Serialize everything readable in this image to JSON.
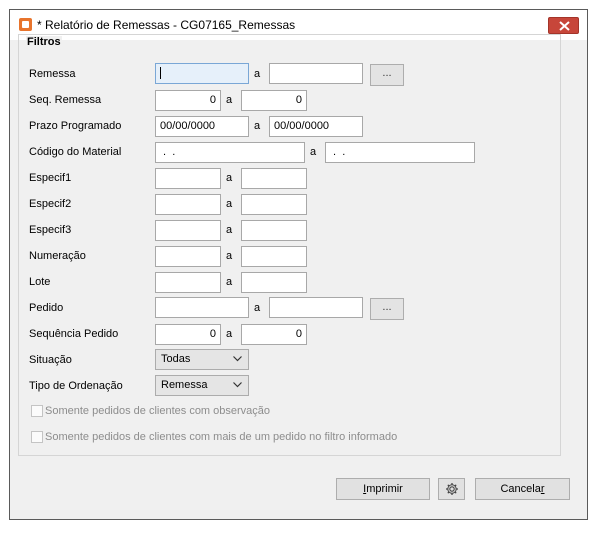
{
  "window": {
    "title": "* Relatório de Remessas - CG07165_Remessas"
  },
  "group": {
    "label": "Filtros"
  },
  "separator": "a",
  "fields": {
    "remessa": {
      "label": "Remessa",
      "from": "",
      "to": ""
    },
    "seq_remessa": {
      "label": "Seq. Remessa",
      "from": "0",
      "to": "0"
    },
    "prazo_programado": {
      "label": "Prazo Programado",
      "from": "00/00/0000",
      "to": "00/00/0000"
    },
    "codigo_material": {
      "label": "Código do Material",
      "from": " .  .",
      "to": " .  ."
    },
    "especif1": {
      "label": "Especif1",
      "from": "",
      "to": ""
    },
    "especif2": {
      "label": "Especif2",
      "from": "",
      "to": ""
    },
    "especif3": {
      "label": "Especif3",
      "from": "",
      "to": ""
    },
    "numeracao": {
      "label": "Numeração",
      "from": "",
      "to": ""
    },
    "lote": {
      "label": "Lote",
      "from": "",
      "to": ""
    },
    "pedido": {
      "label": "Pedido",
      "from": "",
      "to": ""
    },
    "sequencia_pedido": {
      "label": "Sequência Pedido",
      "from": "0",
      "to": "0"
    },
    "situacao": {
      "label": "Situação",
      "value": "Todas"
    },
    "tipo_ordenacao": {
      "label": "Tipo de Ordenação",
      "value": "Remessa"
    }
  },
  "browse_label": "...",
  "checkboxes": [
    {
      "label": "Somente pedidos de clientes com observação",
      "checked": false,
      "enabled": false
    },
    {
      "label": "Somente pedidos de clientes com mais de um pedido no filtro informado",
      "checked": false,
      "enabled": false
    }
  ],
  "buttons": {
    "imprimir_pre": "",
    "imprimir_key": "I",
    "imprimir_post": "mprimir",
    "cancelar_pre": "Cancela",
    "cancelar_key": "r",
    "cancelar_post": ""
  },
  "icons": {
    "app": "report-app-icon",
    "close": "close-icon",
    "settings": "gear-icon",
    "dropdown": "chevron-down-icon"
  },
  "colors": {
    "close_button": "#c7463a",
    "focused_input": "#e6f0fa",
    "app_icon": "#e8742c"
  }
}
